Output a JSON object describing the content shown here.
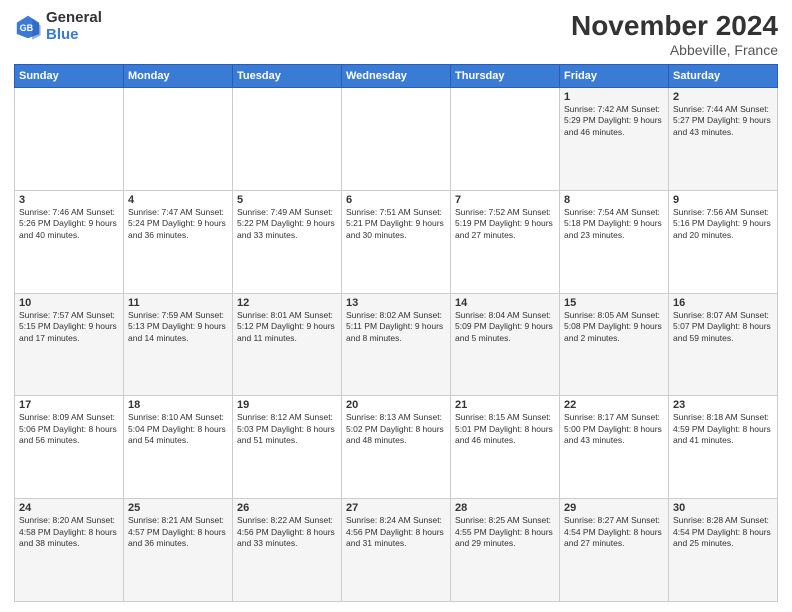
{
  "logo": {
    "general": "General",
    "blue": "Blue"
  },
  "header": {
    "month": "November 2024",
    "location": "Abbeville, France"
  },
  "days_of_week": [
    "Sunday",
    "Monday",
    "Tuesday",
    "Wednesday",
    "Thursday",
    "Friday",
    "Saturday"
  ],
  "weeks": [
    [
      {
        "day": "",
        "info": ""
      },
      {
        "day": "",
        "info": ""
      },
      {
        "day": "",
        "info": ""
      },
      {
        "day": "",
        "info": ""
      },
      {
        "day": "",
        "info": ""
      },
      {
        "day": "1",
        "info": "Sunrise: 7:42 AM\nSunset: 5:29 PM\nDaylight: 9 hours and 46 minutes."
      },
      {
        "day": "2",
        "info": "Sunrise: 7:44 AM\nSunset: 5:27 PM\nDaylight: 9 hours and 43 minutes."
      }
    ],
    [
      {
        "day": "3",
        "info": "Sunrise: 7:46 AM\nSunset: 5:26 PM\nDaylight: 9 hours and 40 minutes."
      },
      {
        "day": "4",
        "info": "Sunrise: 7:47 AM\nSunset: 5:24 PM\nDaylight: 9 hours and 36 minutes."
      },
      {
        "day": "5",
        "info": "Sunrise: 7:49 AM\nSunset: 5:22 PM\nDaylight: 9 hours and 33 minutes."
      },
      {
        "day": "6",
        "info": "Sunrise: 7:51 AM\nSunset: 5:21 PM\nDaylight: 9 hours and 30 minutes."
      },
      {
        "day": "7",
        "info": "Sunrise: 7:52 AM\nSunset: 5:19 PM\nDaylight: 9 hours and 27 minutes."
      },
      {
        "day": "8",
        "info": "Sunrise: 7:54 AM\nSunset: 5:18 PM\nDaylight: 9 hours and 23 minutes."
      },
      {
        "day": "9",
        "info": "Sunrise: 7:56 AM\nSunset: 5:16 PM\nDaylight: 9 hours and 20 minutes."
      }
    ],
    [
      {
        "day": "10",
        "info": "Sunrise: 7:57 AM\nSunset: 5:15 PM\nDaylight: 9 hours and 17 minutes."
      },
      {
        "day": "11",
        "info": "Sunrise: 7:59 AM\nSunset: 5:13 PM\nDaylight: 9 hours and 14 minutes."
      },
      {
        "day": "12",
        "info": "Sunrise: 8:01 AM\nSunset: 5:12 PM\nDaylight: 9 hours and 11 minutes."
      },
      {
        "day": "13",
        "info": "Sunrise: 8:02 AM\nSunset: 5:11 PM\nDaylight: 9 hours and 8 minutes."
      },
      {
        "day": "14",
        "info": "Sunrise: 8:04 AM\nSunset: 5:09 PM\nDaylight: 9 hours and 5 minutes."
      },
      {
        "day": "15",
        "info": "Sunrise: 8:05 AM\nSunset: 5:08 PM\nDaylight: 9 hours and 2 minutes."
      },
      {
        "day": "16",
        "info": "Sunrise: 8:07 AM\nSunset: 5:07 PM\nDaylight: 8 hours and 59 minutes."
      }
    ],
    [
      {
        "day": "17",
        "info": "Sunrise: 8:09 AM\nSunset: 5:06 PM\nDaylight: 8 hours and 56 minutes."
      },
      {
        "day": "18",
        "info": "Sunrise: 8:10 AM\nSunset: 5:04 PM\nDaylight: 8 hours and 54 minutes."
      },
      {
        "day": "19",
        "info": "Sunrise: 8:12 AM\nSunset: 5:03 PM\nDaylight: 8 hours and 51 minutes."
      },
      {
        "day": "20",
        "info": "Sunrise: 8:13 AM\nSunset: 5:02 PM\nDaylight: 8 hours and 48 minutes."
      },
      {
        "day": "21",
        "info": "Sunrise: 8:15 AM\nSunset: 5:01 PM\nDaylight: 8 hours and 46 minutes."
      },
      {
        "day": "22",
        "info": "Sunrise: 8:17 AM\nSunset: 5:00 PM\nDaylight: 8 hours and 43 minutes."
      },
      {
        "day": "23",
        "info": "Sunrise: 8:18 AM\nSunset: 4:59 PM\nDaylight: 8 hours and 41 minutes."
      }
    ],
    [
      {
        "day": "24",
        "info": "Sunrise: 8:20 AM\nSunset: 4:58 PM\nDaylight: 8 hours and 38 minutes."
      },
      {
        "day": "25",
        "info": "Sunrise: 8:21 AM\nSunset: 4:57 PM\nDaylight: 8 hours and 36 minutes."
      },
      {
        "day": "26",
        "info": "Sunrise: 8:22 AM\nSunset: 4:56 PM\nDaylight: 8 hours and 33 minutes."
      },
      {
        "day": "27",
        "info": "Sunrise: 8:24 AM\nSunset: 4:56 PM\nDaylight: 8 hours and 31 minutes."
      },
      {
        "day": "28",
        "info": "Sunrise: 8:25 AM\nSunset: 4:55 PM\nDaylight: 8 hours and 29 minutes."
      },
      {
        "day": "29",
        "info": "Sunrise: 8:27 AM\nSunset: 4:54 PM\nDaylight: 8 hours and 27 minutes."
      },
      {
        "day": "30",
        "info": "Sunrise: 8:28 AM\nSunset: 4:54 PM\nDaylight: 8 hours and 25 minutes."
      }
    ]
  ]
}
